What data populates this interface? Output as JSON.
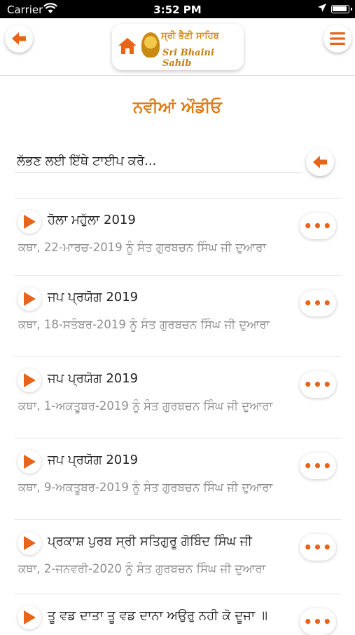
{
  "status_bar": {
    "carrier": "Carrier",
    "time": "3:52 PM"
  },
  "header": {
    "logo_punjabi": "ਸ੍ਰੀ ਭੈਣੀ ਸਾਹਿਬ",
    "logo_english": "Sri Bhaini Sahib"
  },
  "page": {
    "title": "ਨਵੀਆਂ ਔਡੀਓ"
  },
  "search": {
    "placeholder": "ਲੱਭਣ ਲਈ ਇੱਥੇ ਟਾਈਪ ਕਰੋ..."
  },
  "audio_list": [
    {
      "title": "ਹੋਲਾ ਮਹੁੱਲਾ 2019",
      "subtitle": "ਕਥਾ, 22-ਮਾਰਚ-2019 ਨੂੰ ਸੰਤ ਗੁਰਬਚਨ ਸਿੰਘ ਜੀ ਦੁਆਰਾ",
      "more": "•••"
    },
    {
      "title": "ਜਪ ਪ੍ਰਯੋਗ 2019",
      "subtitle": "ਕਥਾ, 18-ਸਤੰਬਰ-2019 ਨੂੰ ਸੰਤ ਗੁਰਬਚਨ ਸਿੰਘ ਜੀ ਦੁਆਰਾ",
      "more": "•••"
    },
    {
      "title": "ਜਪ ਪ੍ਰਯੋਗ 2019",
      "subtitle": "ਕਥਾ, 1-ਅਕਤੂਬਰ-2019 ਨੂੰ ਸੰਤ ਗੁਰਬਚਨ ਸਿੰਘ ਜੀ ਦੁਆਰਾ",
      "more": "•••"
    },
    {
      "title": "ਜਪ ਪ੍ਰਯੋਗ 2019",
      "subtitle": "ਕਥਾ, 9-ਅਕਤੂਬਰ-2019 ਨੂੰ ਸੰਤ ਗੁਰਬਚਨ ਸਿੰਘ ਜੀ ਦੁਆਰਾ",
      "more": "•••"
    },
    {
      "title": "ਪ੍ਰਕਾਸ਼ ਪੁਰਬ ਸ੍ਰੀ ਸਤਿਗੁਰੂ ਗੋਬਿੰਦ ਸਿੰਘ ਜੀ",
      "subtitle": "ਕਥਾ, 2-ਜਨਵਰੀ-2020 ਨੂੰ ਸੰਤ ਗੁਰਬਚਨ ਸਿੰਘ ਜੀ ਦੁਆਰਾ",
      "more": "•••"
    },
    {
      "title": "ਤੂ ਵਡ ਦਾਤਾ ਤੂ ਵਡ ਦਾਨਾ ਅਉਰੁ ਨਹੀ ਕੋ ਦੂਜਾ ॥",
      "subtitle": "",
      "more": "•••"
    }
  ],
  "colors": {
    "accent": "#e8641a",
    "title": "#e07b16"
  }
}
